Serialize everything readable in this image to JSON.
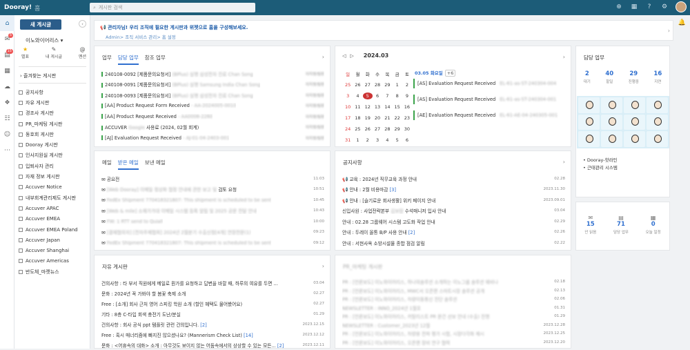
{
  "topbar": {
    "logo": "Dooray!",
    "home": "홈",
    "search_placeholder": "게시판 검색"
  },
  "rail_badges": [
    "5",
    "15"
  ],
  "sidebar": {
    "new_button": "새 게시글",
    "org": "이노와이어리스 ▾",
    "quick": [
      {
        "icon": "★",
        "label": "별표"
      },
      {
        "icon": "✎",
        "label": "내 게시글"
      },
      {
        "icon": "@",
        "label": "멘션"
      }
    ],
    "favorites": "› 즐겨찾는 게시판",
    "boards": [
      "공지사항",
      "자유 게시판",
      "경조사 게시판",
      "PR_마케팅 게시판",
      "동호회 게시판",
      "Dooray 게시판",
      "인사지원실 게시판",
      "입퇴사자 관리",
      "자재 정보 게시판",
      "Accuver Notice",
      "내부회계관리제도 게시판",
      "Accuver APAC",
      "Accuver EMEA",
      "Accuver EMEA Poland",
      "Accuver Japan",
      "Accuver Shanghai",
      "Accuver Americas",
      "반도체_마켓뉴스"
    ]
  },
  "notice": {
    "line1": "관리자님! 우리 조직에 필요한 게시판과 위젯으로 홈을 구성해보세요.",
    "line2": "Admin> 조직 서비스 관리> 홈 설정"
  },
  "work": {
    "tabs": [
      "업무",
      "담당 업무",
      "참조 업무"
    ],
    "rows": [
      {
        "t": "240108-0092 [제품문의요청서]",
        "b": "(BPlus) 실행 삼성전자 진료 Chan Song",
        "m": "이지영/팀장"
      },
      {
        "t": "240108-0091 [제품문의요청서]",
        "b": "(BPlus) 실행 Samsung India Chan Song",
        "m": "이지영/팀장"
      },
      {
        "t": "240108-0093 [제품문의요청서]",
        "b": "(BPlus) 실행 삼성전자 진료 Chan Song",
        "m": "이지영/팀장"
      },
      {
        "t": "[AA] Product Request Form Received",
        "b": "- AA-2024005-0010",
        "m": "이지영/팀장"
      },
      {
        "t": "[AA] Product Request Received",
        "b": "- AA0006-2260",
        "m": "이지영/팀장"
      },
      {
        "t": "ACCUVER",
        "b": "Google",
        "t2": "사용료 (2024, 02월 회계)",
        "m": "이지영/팀장"
      },
      {
        "t": "[AJ] Evaluation Request Received",
        "b": "- AJ-01-04-2403-001",
        "m": "이지영/팀장"
      }
    ]
  },
  "calendar": {
    "month": "2024.03",
    "weekdays": [
      "일",
      "월",
      "화",
      "수",
      "목",
      "금",
      "토"
    ],
    "weeks": [
      [
        "25",
        "26",
        "27",
        "28",
        "29",
        "1",
        "2"
      ],
      [
        "3",
        "4",
        "5",
        "6",
        "7",
        "8",
        "9"
      ],
      [
        "10",
        "11",
        "12",
        "13",
        "14",
        "15",
        "16"
      ],
      [
        "17",
        "18",
        "19",
        "20",
        "21",
        "22",
        "23"
      ],
      [
        "24",
        "25",
        "26",
        "27",
        "28",
        "29",
        "30"
      ],
      [
        "31",
        "1",
        "2",
        "3",
        "4",
        "5",
        "6"
      ]
    ],
    "today": "5",
    "selected": "03.05 화요일",
    "more": "+6",
    "events": [
      {
        "t": "[AS] Evaluation Request Received",
        "b": "EL-61-as-ST-240304-004"
      },
      {
        "t": "[AS] Evaluation Request Received",
        "b": "EL-61-as-ST-240304-001"
      },
      {
        "t": "[AE] Evaluation Request Received",
        "b": "EL-61-AE-04-240305-001"
      }
    ]
  },
  "tasks": {
    "title": "담당 업무",
    "stats": [
      {
        "n": "2",
        "l": "대기"
      },
      {
        "n": "40",
        "l": "할일"
      },
      {
        "n": "29",
        "l": "진행중"
      },
      {
        "n": "16",
        "l": "지연"
      }
    ]
  },
  "links": [
    "Dooray-핫라인",
    "근태관리 시스템"
  ],
  "mail": {
    "tabs": [
      "메일",
      "받은 메일",
      "보낸 메일"
    ],
    "rows": [
      {
        "t": "공요전",
        "b": "",
        "m": "11:03"
      },
      {
        "t": "",
        "b": "[Web Dooray] 이메일 정상화 협정 안내에 관한 보고 및",
        "t2": "검토 요청",
        "m": "10:51"
      },
      {
        "t": "",
        "b": "FedEx Shipment 770418321807: This shipment is scheduled to be sent",
        "m": "10:45"
      },
      {
        "t": "",
        "b": "[Web & mile] 소재가가대 이메일 시스템 등록 알림 및 2025 공문 전달 안내",
        "m": "10:43"
      },
      {
        "t": "",
        "b": "FW: 1 RTT send to Quiall",
        "m": "10:00"
      },
      {
        "t": "",
        "b": "[결재협의자] [전자주제협회] 2024년 2월분기 수출신청[4개] 연장전문(1)",
        "m": "09:23"
      },
      {
        "t": "",
        "b": "FedEx Shipment 770418321807: This shipment is scheduled to be sent",
        "m": "09:12"
      }
    ]
  },
  "news": {
    "title": "공지사항",
    "rows": [
      {
        "t": "📢 교육 : 2024년 직무교육 과정 안내",
        "c": "",
        "m": "02.28"
      },
      {
        "t": "📢 안내 : 2월 비용마감",
        "c": "[3]",
        "m": "2023.11.30"
      },
      {
        "t": "📢 안내 : [슬기로운 회사생활] 위키 페이지 안내",
        "c": "",
        "m": "2023.09.01"
      },
      {
        "t": "신입사원 : 사업전략본부",
        "b": "김보람",
        "t2": "수석매니저 입사 안내",
        "m": "03.04"
      },
      {
        "t": "안내 : 02.28 그룹웨어 시스템 고도화 작업 안내",
        "c": "",
        "m": "02.29"
      },
      {
        "t": "안내 : 두레이 올통 B/P 사용 안내",
        "c": "[2]",
        "m": "02.26"
      },
      {
        "t": "안내 : 서현사옥 소방시설물 종합 점검 알림",
        "c": "",
        "m": "02.22"
      }
    ]
  },
  "mini": {
    "stats": [
      {
        "icon": "✉",
        "n": "15",
        "l": "안 읽음"
      },
      {
        "icon": "▤",
        "n": "71",
        "l": "담당 업무"
      },
      {
        "icon": "▦",
        "n": "0",
        "l": "오늘 일정"
      }
    ]
  },
  "free": {
    "title": "자유 게시판",
    "rows": [
      {
        "t": "건의사항 : 타 부서 직원에게 메일로 뭔가를 요청하고 답변을 바랄 때, 하루의 여유를 두면 ...",
        "m": "03.04"
      },
      {
        "t": "문화 : 2024년 꼭 가봐야 할 봄꽃 축제 소개",
        "m": "02.27"
      },
      {
        "t": "Free : [소개] 회사 근처 영어 스피킹 학원 소개 (할인 혜택도 물어봤어요)",
        "m": "02.27"
      },
      {
        "t": "기타 : 8층 C-타입 회색 충전기 도난/분실",
        "m": "01.29"
      },
      {
        "t": "건의사항 : 회사 공식 ppt 템플릿 관련 건의입니다.",
        "c": "[2]",
        "m": "2023.12.15"
      },
      {
        "t": "Free : 혹시 매너리즘에 빠지진 않으셨나요? (Mannerism Check List)",
        "c": "[14]",
        "m": "2023.12.12"
      },
      {
        "t": "문화 : <어휴속의 대화> 소개 : 아무것도 보이지 않는 어둠속에서의 상상할 수 있는 모든...",
        "c": "[2]",
        "m": "2023.12.11"
      }
    ]
  },
  "pr": {
    "title": "PR_마케팅 게시판",
    "rows": [
      {
        "b": "PR : [언론보도] 이노와이어리스, 하나의솔루션 소개하는 이노그룹 솔루션 웨비나",
        "m": "02.18"
      },
      {
        "b": "PR : [언론보도] 이노와이어리스, MWC서 오픈랜 스마트시장 솔루션 공개",
        "m": "02.13"
      },
      {
        "b": "PR : [언론보도] 이노와이어리스, 차량이동통신 진단 솔루션",
        "m": "02.06"
      },
      {
        "b": "NEWSLETTER : INNO_2024년 1월호",
        "m": "01.31"
      },
      {
        "b": "PR : [언론보도] 이노와이어리스, 카탈리스트 PR 문건 선보 안내 (수출) 진행",
        "m": "01.29"
      },
      {
        "b": "NEWSLETTER : Customer_2023년 12월",
        "m": "2023.12.28"
      },
      {
        "b": "PR : [언론보도] 이노와이어리스, 차량용 전파 평가 시험, 시장다각화 제시",
        "m": "2023.12.25"
      },
      {
        "b": "PR : [언론보도] 이노와이어리스, 오픈랜 장비 연구 협력",
        "m": "2023.12.20"
      }
    ]
  }
}
